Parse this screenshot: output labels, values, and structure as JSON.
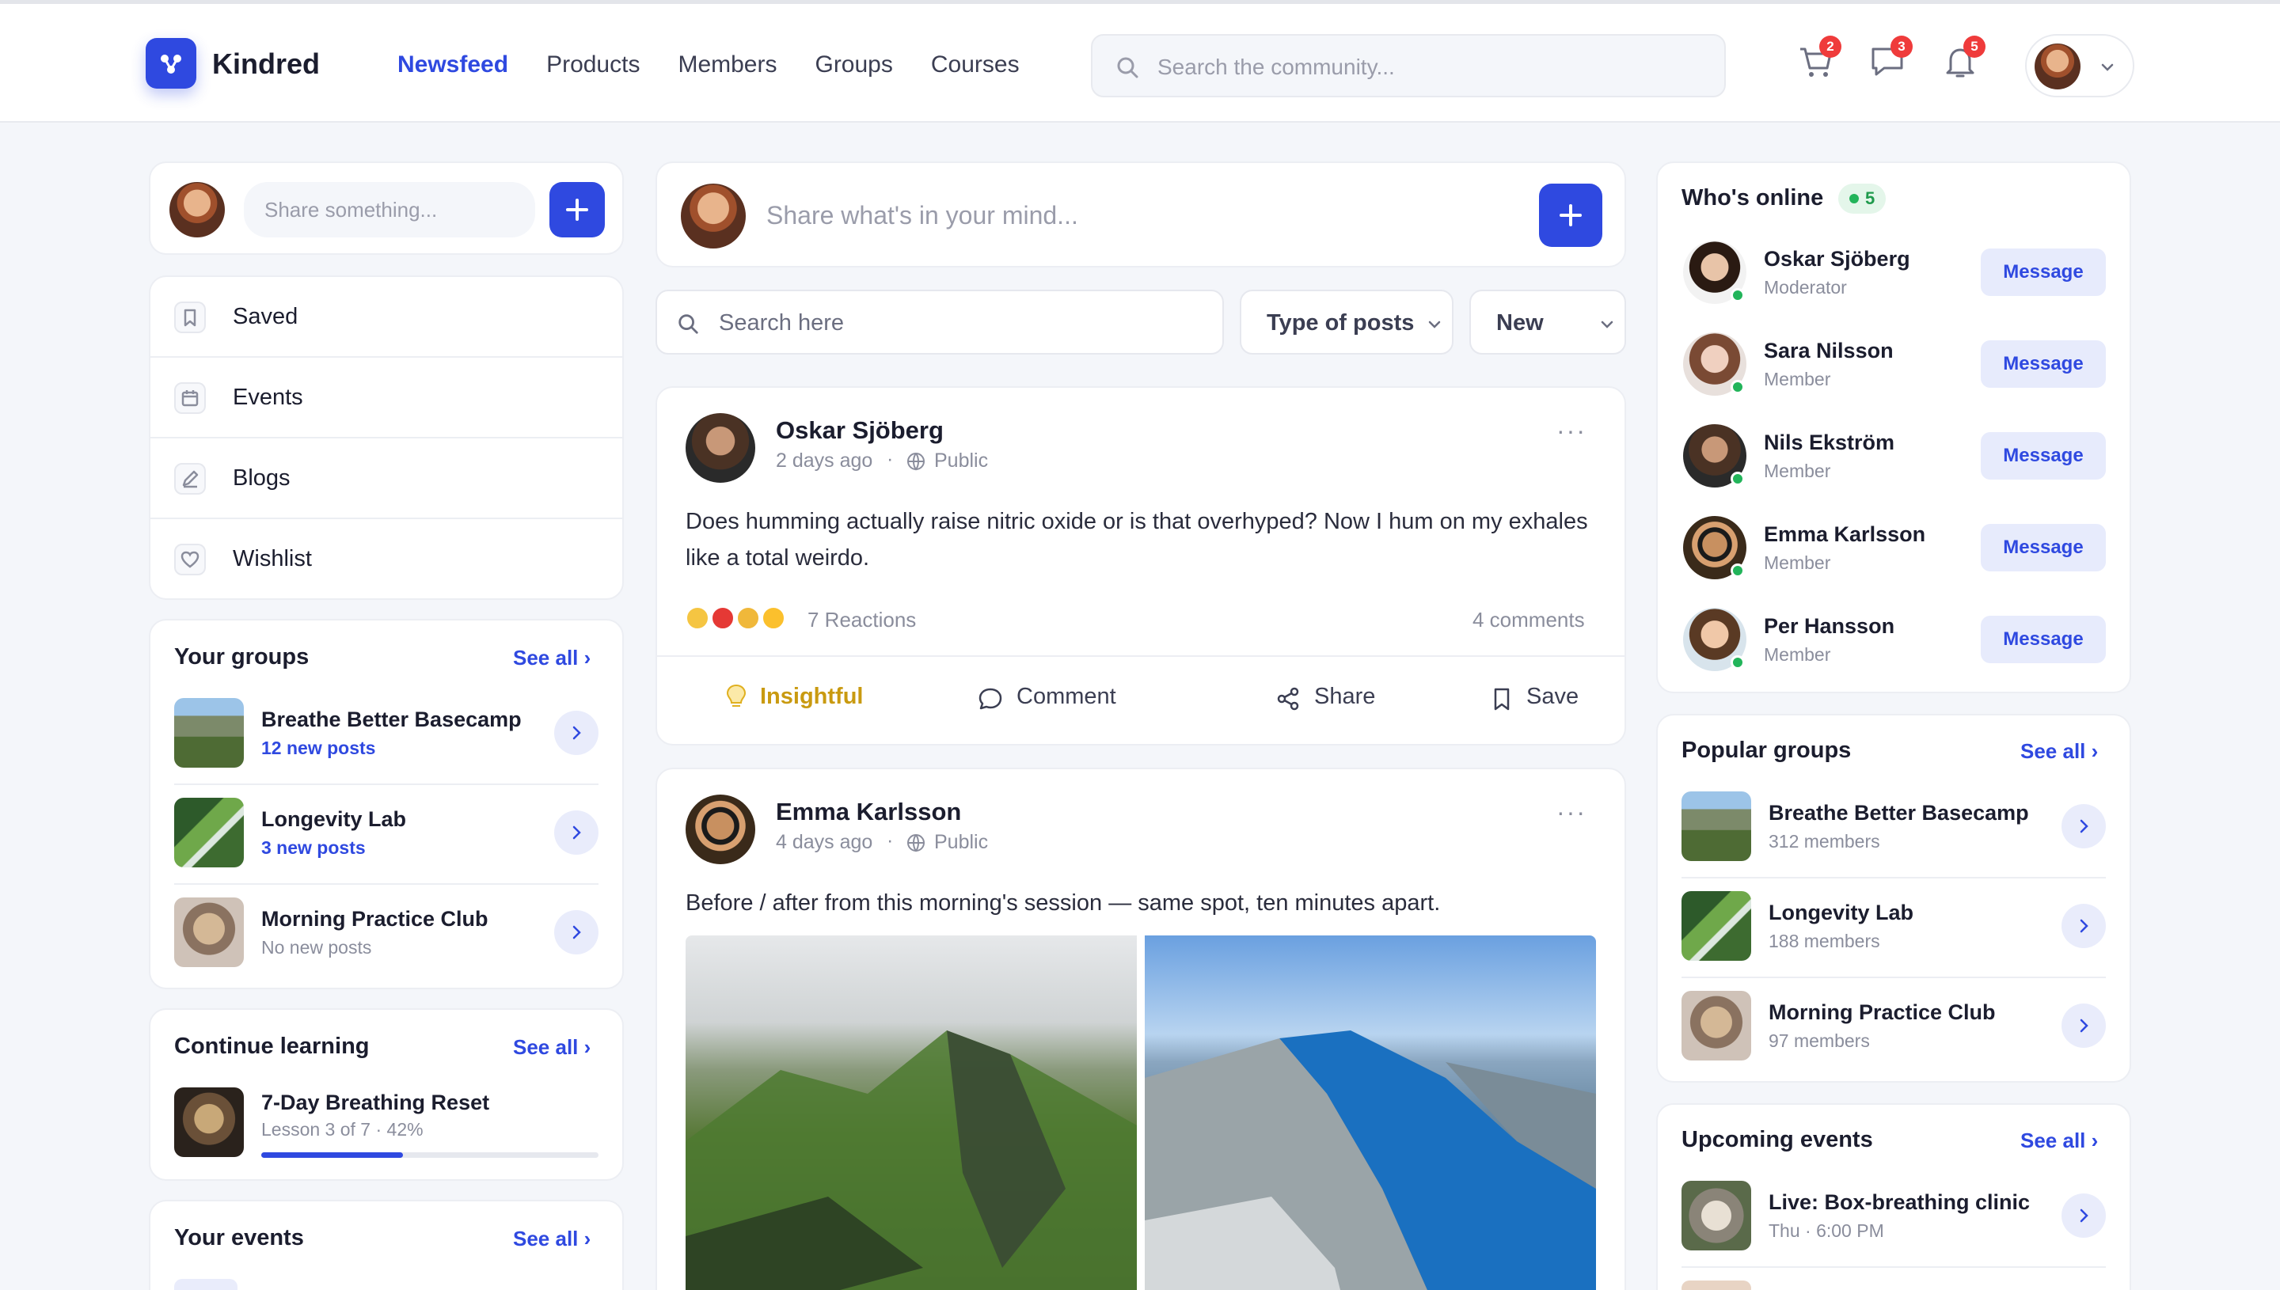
{
  "brand": {
    "name": "Kindred",
    "accent": "#2f49e0"
  },
  "nav": {
    "items": [
      "Newsfeed",
      "Products",
      "Members",
      "Groups",
      "Courses"
    ],
    "active": "Newsfeed"
  },
  "search": {
    "placeholder": "Search the community..."
  },
  "header_icons": {
    "cart": {
      "icon": "cart-icon",
      "badge": "2"
    },
    "messages": {
      "icon": "chat-icon",
      "badge": "3"
    },
    "notifications": {
      "icon": "bell-icon",
      "badge": "5"
    }
  },
  "left": {
    "composer": {
      "placeholder": "Share something..."
    },
    "menu": [
      {
        "label": "Saved",
        "icon": "bookmark-icon"
      },
      {
        "label": "Events",
        "icon": "calendar-icon"
      },
      {
        "label": "Blogs",
        "icon": "pencil-icon"
      },
      {
        "label": "Wishlist",
        "icon": "heart-icon"
      }
    ],
    "your_groups": {
      "title": "Your groups",
      "see_all": "See all",
      "items": [
        {
          "name": "Breathe Better Basecamp",
          "sub": "12 new posts"
        },
        {
          "name": "Longevity Lab",
          "sub": "3 new posts"
        },
        {
          "name": "Morning Practice Club",
          "sub": "No new posts"
        }
      ]
    },
    "continue_learning": {
      "title": "Continue learning",
      "see_all": "See all",
      "course": {
        "name": "7-Day Breathing Reset",
        "sub": "Lesson 3 of 7 · 42%",
        "progress": 0.42
      }
    },
    "your_events": {
      "title": "Your events",
      "see_all": "See all"
    }
  },
  "feed": {
    "composer": {
      "placeholder": "Share what's in your mind..."
    },
    "search_placeholder": "Search here",
    "filter_type": "Type of posts",
    "filter_sort": "New",
    "posts": [
      {
        "author": "Oskar Sjöberg",
        "time": "2 days ago",
        "visibility": "Public",
        "text": "Does humming actually raise nitric oxide or is that overhyped? Now I hum on my exhales like a total weirdo.",
        "reactions": "7 Reactions",
        "comments": "4 comments",
        "actions": {
          "insightful": "Insightful",
          "comment": "Comment",
          "share": "Share",
          "save": "Save"
        }
      },
      {
        "author": "Emma Karlsson",
        "time": "4 days ago",
        "visibility": "Public",
        "text": "Before / after from this morning's session — same spot, ten minutes apart."
      }
    ]
  },
  "right": {
    "whos_online": {
      "title": "Who's online",
      "count": "5",
      "button": "Message",
      "people": [
        {
          "name": "Oskar Sjöberg",
          "role": "Moderator"
        },
        {
          "name": "Sara Nilsson",
          "role": "Member"
        },
        {
          "name": "Nils Ekström",
          "role": "Member"
        },
        {
          "name": "Emma Karlsson",
          "role": "Member"
        },
        {
          "name": "Per Hansson",
          "role": "Member"
        }
      ]
    },
    "popular_groups": {
      "title": "Popular groups",
      "see_all": "See all",
      "items": [
        {
          "name": "Breathe Better Basecamp",
          "sub": "312 members"
        },
        {
          "name": "Longevity Lab",
          "sub": "188 members"
        },
        {
          "name": "Morning Practice Club",
          "sub": "97 members"
        }
      ]
    },
    "upcoming_events": {
      "title": "Upcoming events",
      "see_all": "See all",
      "items": [
        {
          "name": "Live: Box-breathing clinic",
          "sub": "Thu · 6:00 PM"
        }
      ]
    }
  }
}
